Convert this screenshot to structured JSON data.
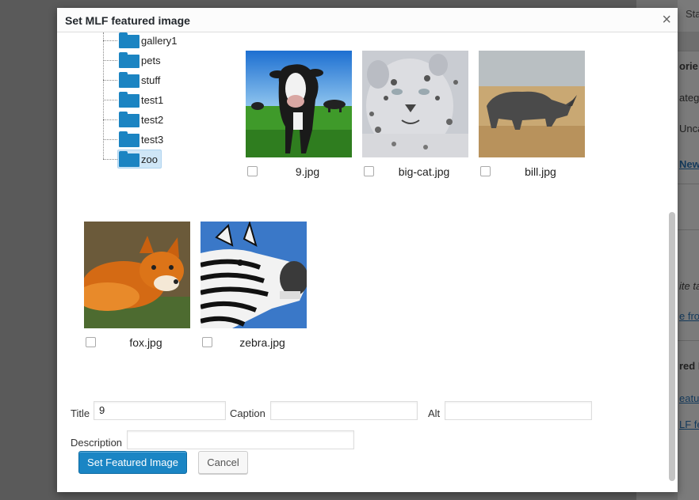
{
  "background": {
    "tab_label": "Sta",
    "texts": [
      "orie",
      "atego",
      "Unca",
      "New",
      "ite ta",
      "e fro",
      "red I",
      "eature",
      "LF fea"
    ]
  },
  "dialog": {
    "title": "Set MLF featured image",
    "close_glyph": "×"
  },
  "folders": [
    {
      "label": "gallery1",
      "selected": false
    },
    {
      "label": "pets",
      "selected": false
    },
    {
      "label": "stuff",
      "selected": false
    },
    {
      "label": "test1",
      "selected": false
    },
    {
      "label": "test2",
      "selected": false
    },
    {
      "label": "test3",
      "selected": false
    },
    {
      "label": "zoo",
      "selected": true
    }
  ],
  "images": [
    {
      "filename": "9.jpg",
      "subject": "cow",
      "checked": false
    },
    {
      "filename": "big-cat.jpg",
      "subject": "snow-leopard",
      "checked": false
    },
    {
      "filename": "bill.jpg",
      "subject": "rhino",
      "checked": false
    },
    {
      "filename": "fox.jpg",
      "subject": "fox",
      "checked": false
    },
    {
      "filename": "zebra.jpg",
      "subject": "zebra",
      "checked": false
    }
  ],
  "form": {
    "title_label": "Title",
    "title_value": "9",
    "caption_label": "Caption",
    "caption_value": "",
    "alt_label": "Alt",
    "alt_value": "",
    "description_label": "Description",
    "description_value": ""
  },
  "buttons": {
    "set_featured": "Set Featured Image",
    "cancel": "Cancel"
  },
  "colors": {
    "accent": "#1a85c4",
    "folder": "#1b84c2",
    "selected_folder_bg": "#cfe6f7"
  }
}
